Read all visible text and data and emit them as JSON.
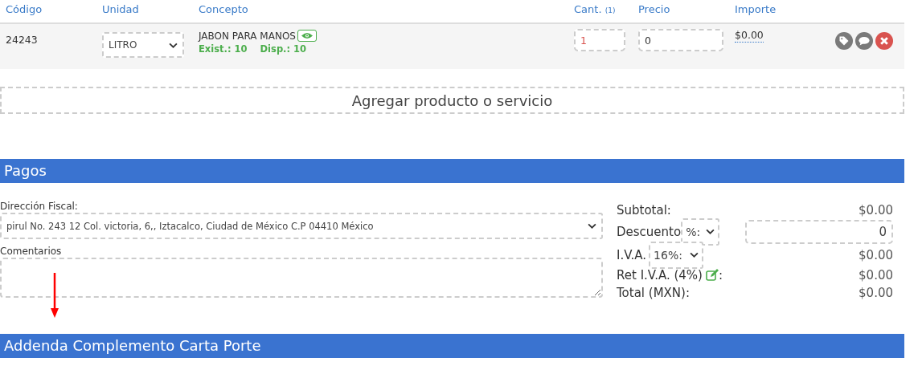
{
  "table": {
    "columns": [
      {
        "label": "Código"
      },
      {
        "label": "Unidad"
      },
      {
        "label": "Concepto"
      },
      {
        "label": "Cant.",
        "note": "(1)"
      },
      {
        "label": "Precio"
      },
      {
        "label": "Importe"
      }
    ],
    "rows": [
      {
        "code": "24243",
        "unit": "LITRO",
        "concept": "JABON PARA MANOS",
        "stock": "Exist.: 10",
        "available": "Disp.: 10",
        "quantity": "1",
        "price": "0",
        "amount": "$0.00"
      }
    ]
  },
  "add_button": "Agregar producto o servicio",
  "payments": {
    "title": "Pagos",
    "address_label": "Dirección Fiscal:",
    "address": "pirul No. 243 12 Col. victoria, 6,, Iztacalco, Ciudad de México C.P 04410 México",
    "comments_label": "Comentarios",
    "totals": [
      {
        "kind": "plain",
        "label": "Subtotal:",
        "value": "$0.00"
      },
      {
        "kind": "discount",
        "label": "Descuento",
        "option": "%:",
        "value": "0"
      },
      {
        "kind": "tax",
        "label": "I.V.A.",
        "option": "16%:",
        "value": "$0.00"
      },
      {
        "kind": "edit",
        "label": "Ret I.V.A. (4%)",
        "suffix": ":",
        "value": "$0.00"
      },
      {
        "kind": "plain",
        "label": "Total (MXN):",
        "value": "$0.00"
      }
    ]
  },
  "addenda": {
    "title": "Addenda Complemento Carta Porte"
  }
}
